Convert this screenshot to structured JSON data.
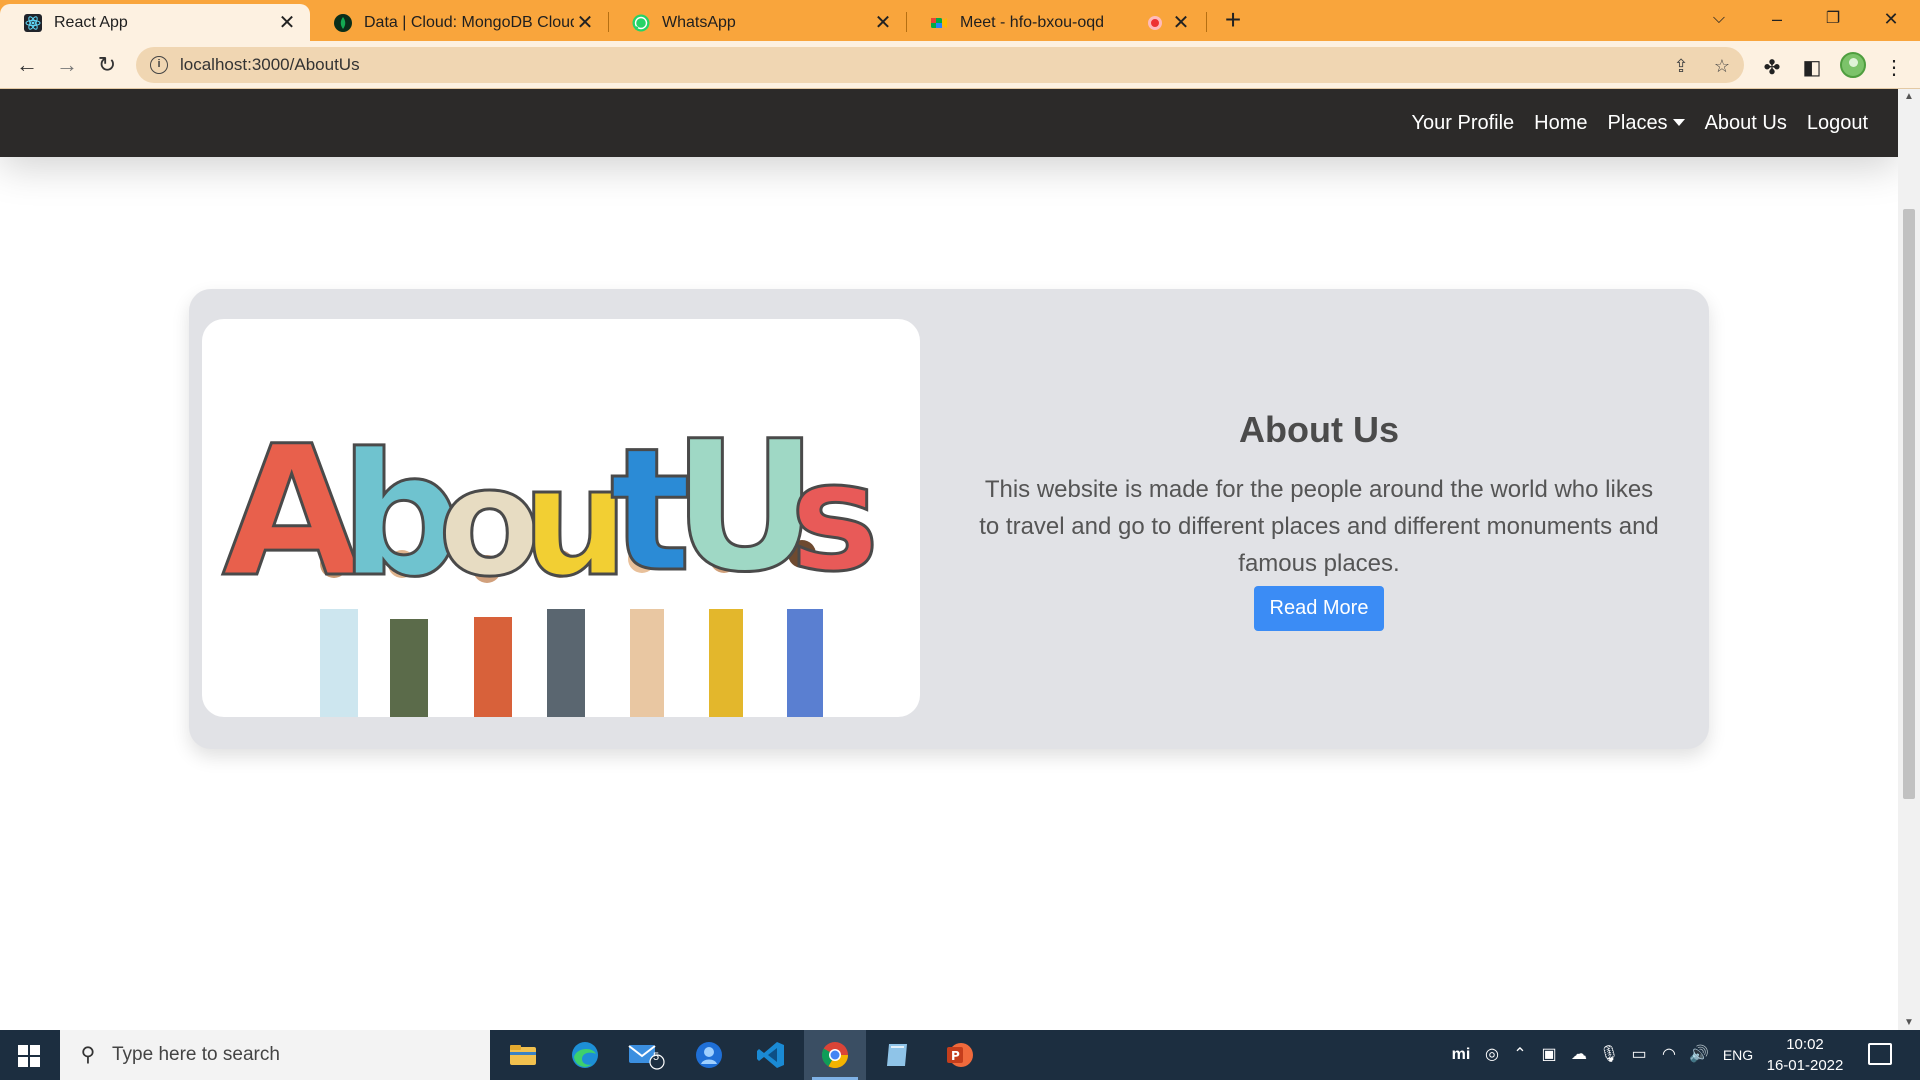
{
  "browser": {
    "tabs": [
      {
        "label": "React App",
        "active": true
      },
      {
        "label": "Data | Cloud: MongoDB Cloud",
        "active": false
      },
      {
        "label": "WhatsApp",
        "active": false
      },
      {
        "label": "Meet - hfo-bxou-oqd",
        "active": false
      }
    ],
    "url": "localhost:3000/AboutUs",
    "accent": "#f9a53c"
  },
  "navbar": {
    "links": [
      "Your Profile",
      "Home",
      "Places",
      "About Us",
      "Logout"
    ]
  },
  "about": {
    "image_text": "AboutUs",
    "heading": "About Us",
    "description": "This website is made for the people around the world who likes to travel and go to different places and different monuments and famous places.",
    "button_label": "Read More",
    "button_color": "#3b8cf5"
  },
  "taskbar": {
    "search_placeholder": "Type here to search",
    "mail_badge": "5",
    "language": "ENG",
    "time": "10:02",
    "date": "16-01-2022"
  }
}
